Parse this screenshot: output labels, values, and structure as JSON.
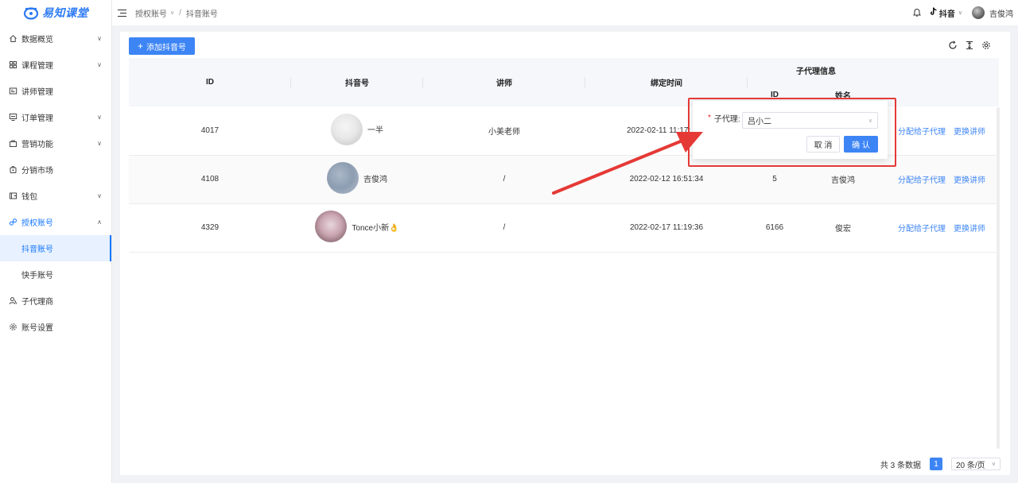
{
  "app": {
    "logo_text": "易知课堂"
  },
  "sidebar": {
    "items": [
      {
        "id": "dashboard",
        "label": "数据概览",
        "icon": "home-icon",
        "chevron": true
      },
      {
        "id": "courses",
        "label": "课程管理",
        "icon": "grid-icon",
        "chevron": true
      },
      {
        "id": "lecturers",
        "label": "讲师管理",
        "icon": "id-card-icon",
        "chevron": false
      },
      {
        "id": "orders",
        "label": "订单管理",
        "icon": "order-icon",
        "chevron": true
      },
      {
        "id": "marketing",
        "label": "营销功能",
        "icon": "bag-icon",
        "chevron": true
      },
      {
        "id": "distribution",
        "label": "分销市场",
        "icon": "shop-icon",
        "chevron": false
      },
      {
        "id": "wallet",
        "label": "钱包",
        "icon": "wallet-icon",
        "chevron": true
      },
      {
        "id": "auth",
        "label": "授权账号",
        "icon": "link-icon",
        "chevron": true,
        "open": true,
        "children": [
          {
            "label": "抖音账号",
            "active": true
          },
          {
            "label": "快手账号"
          }
        ]
      },
      {
        "id": "agents",
        "label": "子代理商",
        "icon": "users-icon",
        "chevron": false
      },
      {
        "id": "settings",
        "label": "账号设置",
        "icon": "gear-icon",
        "chevron": false
      }
    ]
  },
  "header": {
    "breadcrumb": [
      "授权账号",
      "抖音账号"
    ],
    "platform": "抖音",
    "user_name": "吉俊鸿"
  },
  "toolbar": {
    "add_label": "添加抖音号"
  },
  "table": {
    "headers": {
      "id": "ID",
      "account": "抖音号",
      "lecturer": "讲师",
      "bind_time": "绑定时间",
      "agent_group": "子代理信息",
      "agent_id": "ID",
      "agent_name": "姓名"
    },
    "rows": [
      {
        "id": "4017",
        "account": "一半",
        "lecturer": "小美老师",
        "bind_time": "2022-02-11 11:17:",
        "agent_id": "",
        "agent_name": ""
      },
      {
        "id": "4108",
        "account": "吉俊鸿",
        "lecturer": "/",
        "bind_time": "2022-02-12 16:51:34",
        "agent_id": "5",
        "agent_name": "吉俊鸿"
      },
      {
        "id": "4329",
        "account": "Tonce小新👌",
        "lecturer": "/",
        "bind_time": "2022-02-17 11:19:36",
        "agent_id": "6166",
        "agent_name": "俊宏"
      }
    ],
    "actions": {
      "assign": "分配给子代理",
      "change": "更换讲师"
    }
  },
  "pagination": {
    "total_text": "共 3 条数据",
    "current_page": "1",
    "page_size": "20 条/页"
  },
  "popover": {
    "field_label": "子代理:",
    "required_mark": "*",
    "selected_value": "吕小二",
    "cancel_label": "取 消",
    "confirm_label": "确 认"
  },
  "colors": {
    "primary": "#3d85f5",
    "highlight": "#e53935"
  }
}
